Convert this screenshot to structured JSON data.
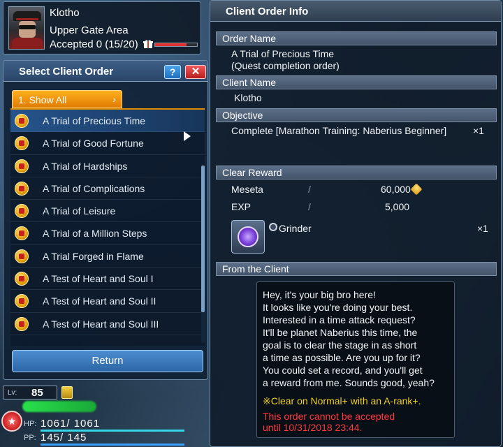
{
  "character": {
    "name": "Klotho",
    "area": "Upper Gate Area",
    "accepted_text": "Accepted 0 (15/20)",
    "accepted_fill": 0.75
  },
  "order_window": {
    "title": "Select Client Order",
    "help_label": "?",
    "close_label": "✕",
    "filter_tab_label": "1. Show All",
    "filter_tab_arrow": "›",
    "quests": [
      {
        "label": "A Trial of Precious Time",
        "selected": true
      },
      {
        "label": "A Trial of Good Fortune"
      },
      {
        "label": "A Trial of Hardships"
      },
      {
        "label": "A Trial of Complications"
      },
      {
        "label": "A Trial of Leisure"
      },
      {
        "label": "A Trial of a Million Steps"
      },
      {
        "label": "A Trial Forged in Flame"
      },
      {
        "label": "A Test of Heart and Soul I"
      },
      {
        "label": "A Test of Heart and Soul II"
      },
      {
        "label": "A Test of Heart and Soul III"
      }
    ],
    "return_label": "Return"
  },
  "info": {
    "title": "Client Order Info",
    "order_name_header": "Order Name",
    "order_name": "A Trial of Precious Time",
    "order_type": "(Quest completion order)",
    "client_name_header": "Client Name",
    "client_name": "Klotho",
    "objective_header": "Objective",
    "objective": "Complete [Marathon Training: Naberius Beginner]",
    "objective_count": "×1",
    "clear_reward_header": "Clear Reward",
    "rewards": {
      "meseta_label": "Meseta",
      "meseta_value": "60,000",
      "exp_label": "EXP",
      "exp_value": "5,000",
      "separator": "/",
      "item_name": "Grinder",
      "item_count": "×1"
    },
    "from_client_header": "From the Client",
    "message_lines": [
      "Hey, it's your big bro here!",
      "It looks like you're doing your best.",
      "Interested in a time attack request?",
      "It'll be planet Naberius this time, the",
      "goal is to clear the stage in as short",
      "a time as possible. Are you up for it?",
      "You could set a record, and you'll get",
      "a reward from me. Sounds good, yeah?"
    ],
    "condition": "※Clear on Normal+ with an A-rank+.",
    "warning_lines": [
      "This order cannot be accepted",
      "until 10/31/2018 23:44."
    ]
  },
  "hud": {
    "level_label": "Lv:",
    "level_value": "85",
    "hp_label": "HP:",
    "hp_value": "1061/ 1061",
    "hp_fill": 1.0,
    "pp_label": "PP:",
    "pp_value": "145/  145",
    "pp_fill": 1.0
  },
  "colors": {
    "accent_orange": "#e07a00",
    "hp_bar": "#35d6e8",
    "pp_bar": "#3aa0ff",
    "accept_bar": "#e03030",
    "warning_red": "#ff3b3b",
    "condition_yellow": "#f0d020"
  }
}
